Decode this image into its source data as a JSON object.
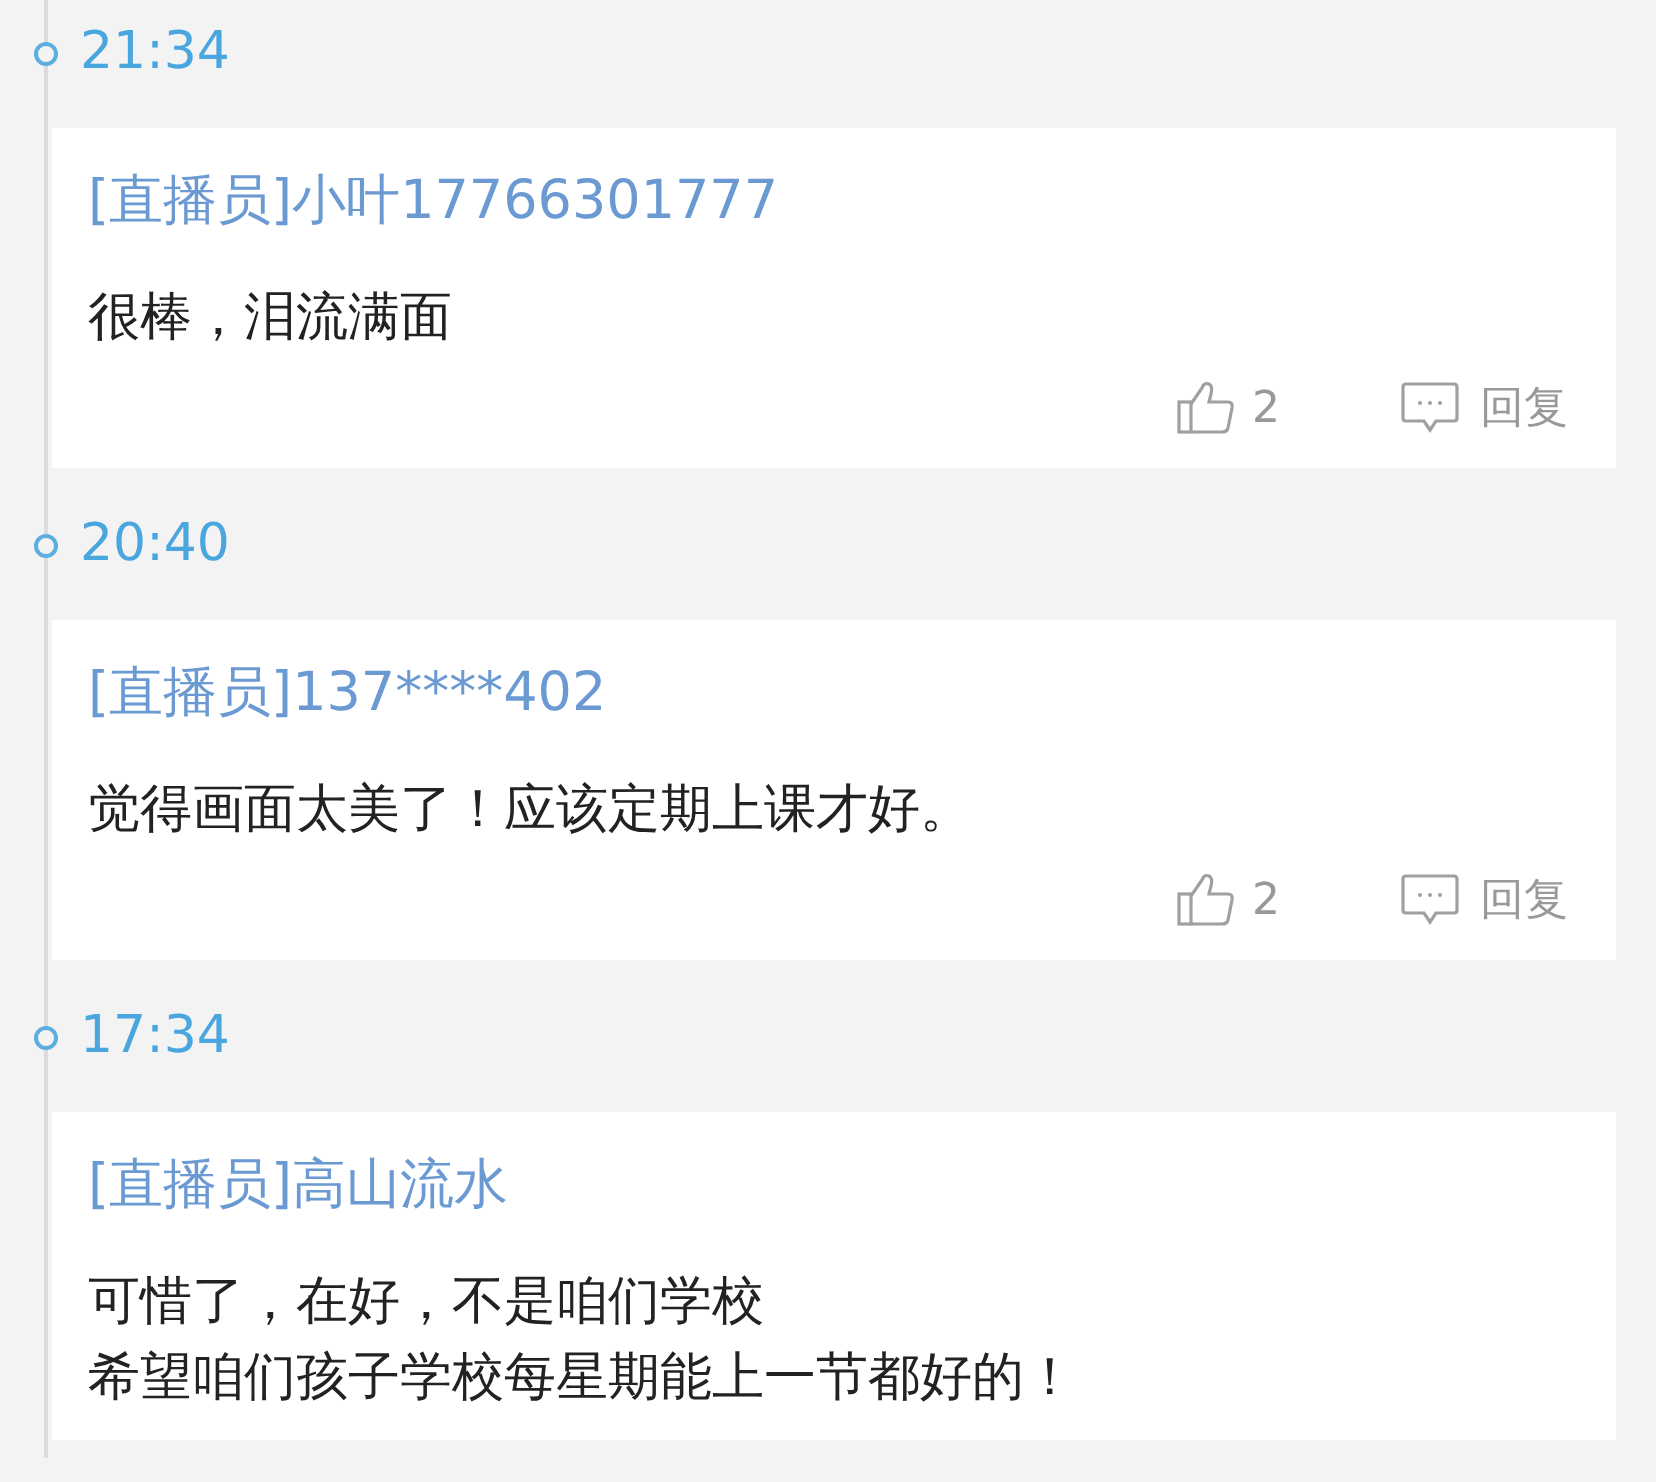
{
  "comments": [
    {
      "time": "21:34",
      "author": "[直播员]小叶17766301777",
      "text": [
        "很棒，泪流满面"
      ],
      "likes": "2",
      "reply": "回复"
    },
    {
      "time": "20:40",
      "author": "[直播员]137****402",
      "text": [
        "觉得画面太美了！应该定期上课才好。"
      ],
      "likes": "2",
      "reply": "回复"
    },
    {
      "time": "17:34",
      "author": "[直播员]高山流水",
      "text": [
        "可惜了，在好，不是咱们学校",
        "希望咱们孩子学校每星期能上一节都好的！"
      ]
    }
  ]
}
